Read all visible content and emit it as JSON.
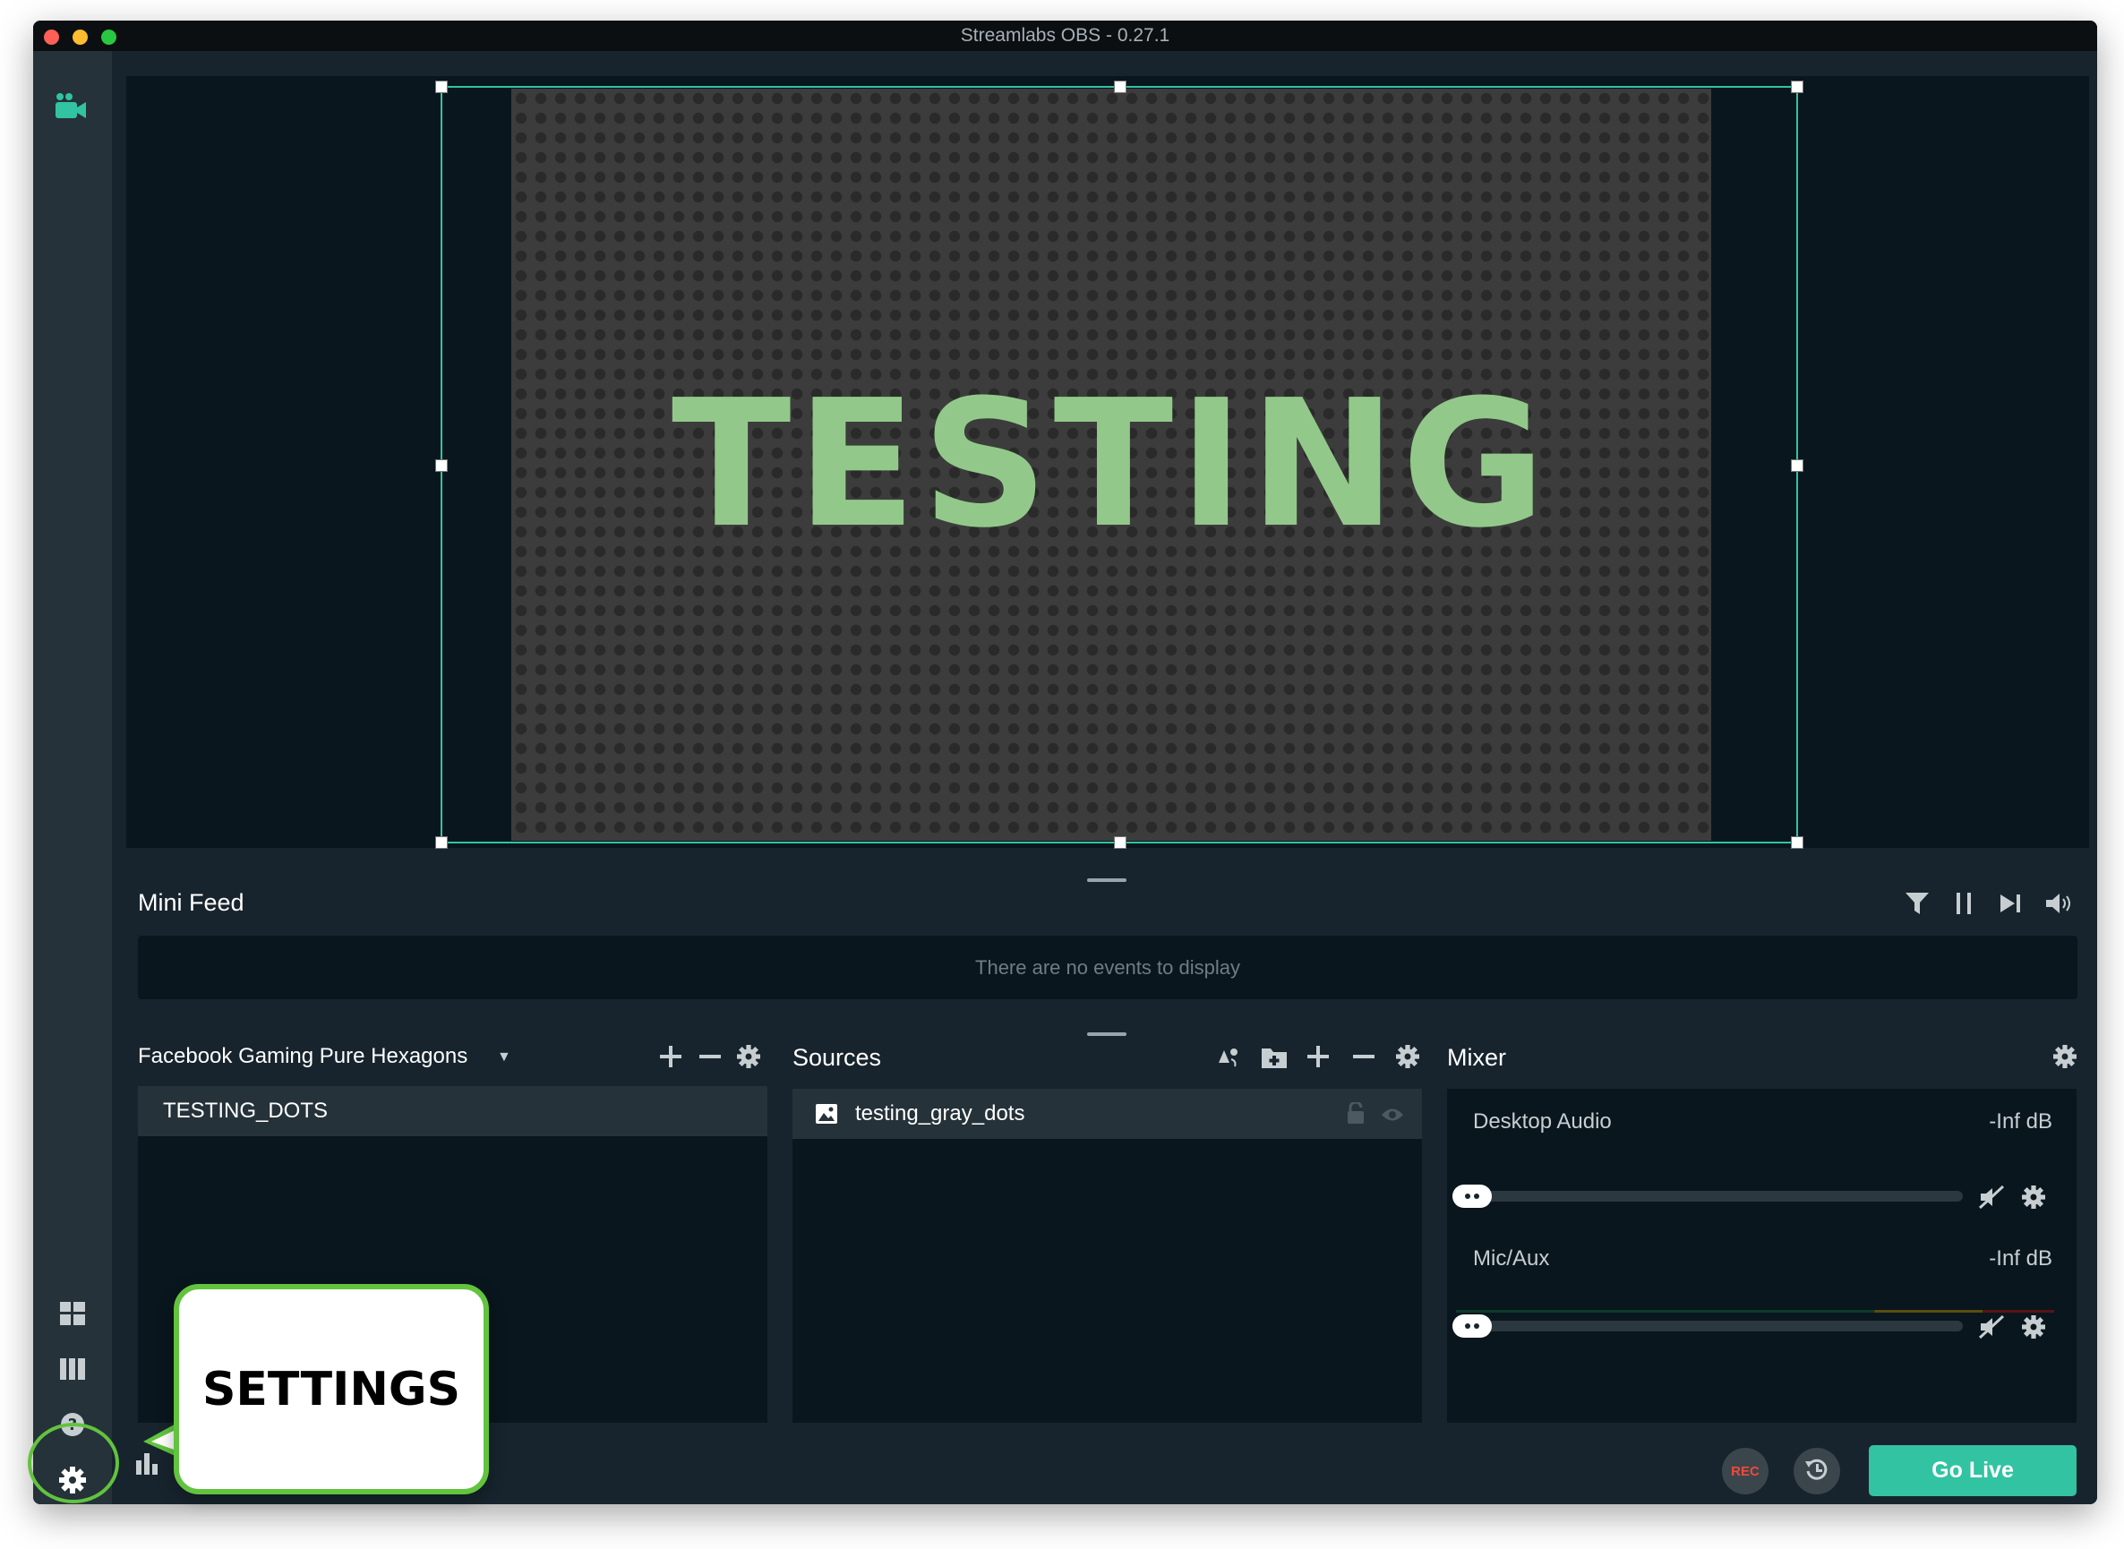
{
  "window": {
    "title": "Streamlabs OBS - 0.27.1"
  },
  "preview": {
    "source_text": "TESTING"
  },
  "minifeed": {
    "title": "Mini Feed",
    "empty_message": "There are no events to display"
  },
  "scenes": {
    "collection_name": "Facebook Gaming Pure Hexagons",
    "items": [
      {
        "label": "TESTING_DOTS",
        "selected": true
      }
    ]
  },
  "sources": {
    "title": "Sources",
    "items": [
      {
        "label": "testing_gray_dots",
        "icon": "image-icon"
      }
    ]
  },
  "mixer": {
    "title": "Mixer",
    "channels": [
      {
        "name": "Desktop Audio",
        "level": "-Inf dB"
      },
      {
        "name": "Mic/Aux",
        "level": "-Inf dB"
      }
    ]
  },
  "footer": {
    "rec_label": "REC",
    "go_live_label": "Go Live"
  },
  "callout": {
    "label": "SETTINGS"
  },
  "colors": {
    "accent": "#31c3a2",
    "panel_bg": "#17242d",
    "nav_bg": "#253239",
    "dark_bg": "#09161d",
    "callout_green": "#62c33e",
    "preview_text": "#92c98a"
  }
}
